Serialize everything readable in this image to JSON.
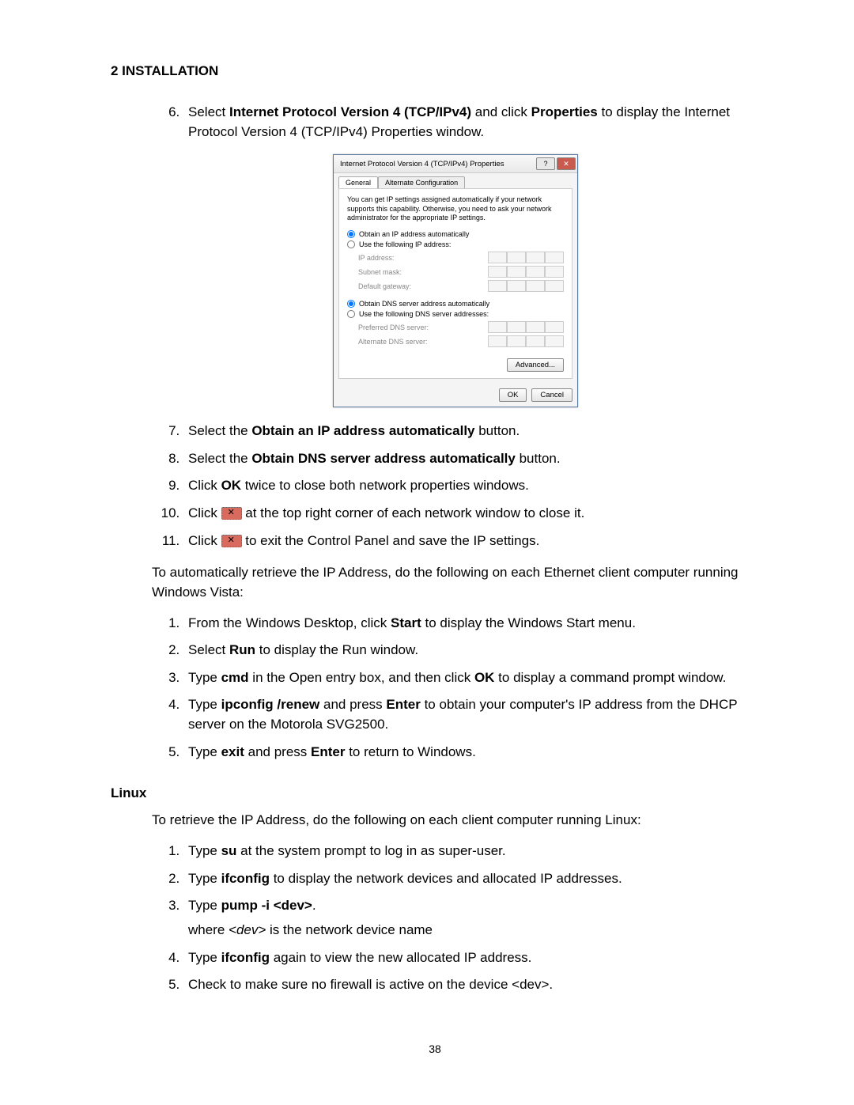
{
  "heading": "2 INSTALLATION",
  "page_number": "38",
  "steps_a": {
    "start": 6,
    "items": [
      {
        "pre": "Select ",
        "b1": "Internet Protocol Version 4 (TCP/IPv4)",
        "mid": " and click ",
        "b2": "Properties",
        "post": " to display the Internet Protocol Version 4 (TCP/IPv4) Properties window."
      }
    ]
  },
  "dialog": {
    "title": "Internet Protocol Version 4 (TCP/IPv4) Properties",
    "help_glyph": "?",
    "close_glyph": "✕",
    "tabs": [
      "General",
      "Alternate Configuration"
    ],
    "desc": "You can get IP settings assigned automatically if your network supports this capability. Otherwise, you need to ask your network administrator for the appropriate IP settings.",
    "radio_ip_auto": "Obtain an IP address automatically",
    "radio_ip_manual": "Use the following IP address:",
    "ip_label": "IP address:",
    "subnet_label": "Subnet mask:",
    "gateway_label": "Default gateway:",
    "radio_dns_auto": "Obtain DNS server address automatically",
    "radio_dns_manual": "Use the following DNS server addresses:",
    "dns_pref": "Preferred DNS server:",
    "dns_alt": "Alternate DNS server:",
    "advanced": "Advanced...",
    "ok": "OK",
    "cancel": "Cancel"
  },
  "steps_b": {
    "s7": {
      "pre": "Select the ",
      "b": "Obtain an IP address automatically",
      "post": " button."
    },
    "s8": {
      "pre": "Select the ",
      "b": "Obtain DNS server address automatically",
      "post": " button."
    },
    "s9": {
      "pre": "Click ",
      "b": "OK",
      "post": " twice to close both network properties windows."
    },
    "s10": {
      "pre": "Click ",
      "post": " at the top right corner of each network window to close it."
    },
    "s11": {
      "pre": "Click ",
      "post": " to exit the Control Panel and save the IP settings."
    }
  },
  "vista_intro": "To automatically retrieve the IP Address, do the following on each Ethernet client computer running Windows Vista:",
  "vista_steps": {
    "s1": {
      "pre": "From the Windows Desktop, click ",
      "b": "Start",
      "post": " to display the Windows Start menu."
    },
    "s2": {
      "pre": "Select ",
      "b": "Run",
      "post": " to display the Run window."
    },
    "s3": {
      "pre1": "Type ",
      "b1": "cmd",
      "mid": " in the Open entry box, and then click ",
      "b2": "OK",
      "post": " to display a command prompt window."
    },
    "s4": {
      "pre1": "Type ",
      "b1": "ipconfig /renew",
      "mid": " and press ",
      "b2": "Enter",
      "post": " to obtain your computer's IP address from the DHCP server on the Motorola SVG2500."
    },
    "s5": {
      "pre1": "Type ",
      "b1": "exit",
      "mid": " and press ",
      "b2": "Enter",
      "post": " to return to Windows."
    }
  },
  "linux_heading": "Linux",
  "linux_intro": "To retrieve the IP Address, do the following on each client computer running Linux:",
  "linux_steps": {
    "s1": {
      "pre": "Type ",
      "b": "su",
      "post": " at the system prompt to log in as super-user."
    },
    "s2": {
      "pre": "Type ",
      "b": "ifconfig",
      "post": " to display the network devices and allocated IP addresses."
    },
    "s3": {
      "pre": "Type ",
      "b": "pump -i <dev>",
      "post": ".",
      "sub_pre": "where ",
      "sub_i": "<dev>",
      "sub_post": " is the network device name"
    },
    "s4": {
      "pre": "Type ",
      "b": "ifconfig",
      "post": " again to view the new allocated IP address."
    },
    "s5": {
      "pre": "",
      "b": "",
      "post": "Check to make sure no firewall is active on the device <dev>."
    }
  }
}
